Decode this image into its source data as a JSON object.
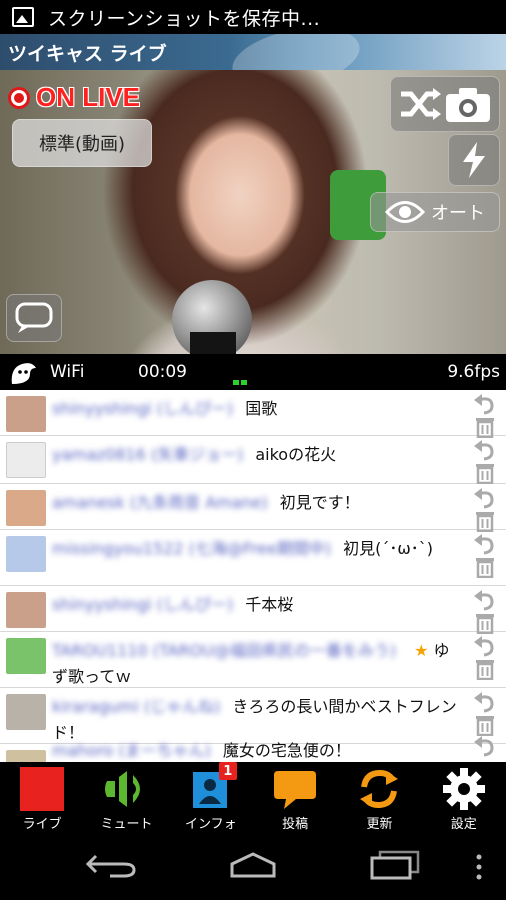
{
  "status_bar": {
    "notification": "スクリーンショットを保存中..."
  },
  "app": {
    "title": "ツイキャス ライブ"
  },
  "video": {
    "live_badge": "ON LIVE",
    "quality_button": "標準(動画)",
    "exposure_button": "オート"
  },
  "info_bar": {
    "network": "WiFi",
    "elapsed": "00:09",
    "fps": "9.6fps"
  },
  "comments": [
    {
      "user": "shinyyshingi (しんぴー)",
      "message": "国歌",
      "avatar_color": "#caa08a",
      "star": ""
    },
    {
      "user": "yamaz0816 (矢車ジョー)",
      "message": "aikoの花火",
      "avatar_color": "#e9e9e9",
      "star": ""
    },
    {
      "user": "amanesk (九条雨音 Amane)",
      "message": "初見です！",
      "avatar_color": "#d9a98a",
      "star": ""
    },
    {
      "user": "missingyou1522 (七海@Free期間中)",
      "message": "初見(´･ω･`)",
      "avatar_color": "#b7c9e8",
      "star": ""
    },
    {
      "user": "shinyyshingi (しんぴー)",
      "message": "千本桜",
      "avatar_color": "#caa08a",
      "star": ""
    },
    {
      "user": "TAROU1110 (TAROU@福田県民の一番をみう)",
      "message": "ゆず歌ってｗ",
      "avatar_color": "#7ac36a",
      "star": "★"
    },
    {
      "user": "kiraragumi (じゃんね)",
      "message": "きろろの長い間かベストフレンド！",
      "avatar_color": "#b9b2a8",
      "star": ""
    },
    {
      "user": "mahoro (まーちゃん)",
      "message": "魔女の宅急便の！",
      "avatar_color": "#cfc0a0",
      "star": ""
    }
  ],
  "toolbar": {
    "live": "ライブ",
    "mute": "ミュート",
    "info": "インフォ",
    "info_badge": "1",
    "post": "投稿",
    "refresh": "更新",
    "settings": "設定"
  },
  "colors": {
    "live_red": "#e8231f",
    "mute_green": "#5cb82e",
    "info_blue": "#1e8fd8",
    "post_orange": "#f39a12",
    "refresh_orange": "#f39a12"
  }
}
